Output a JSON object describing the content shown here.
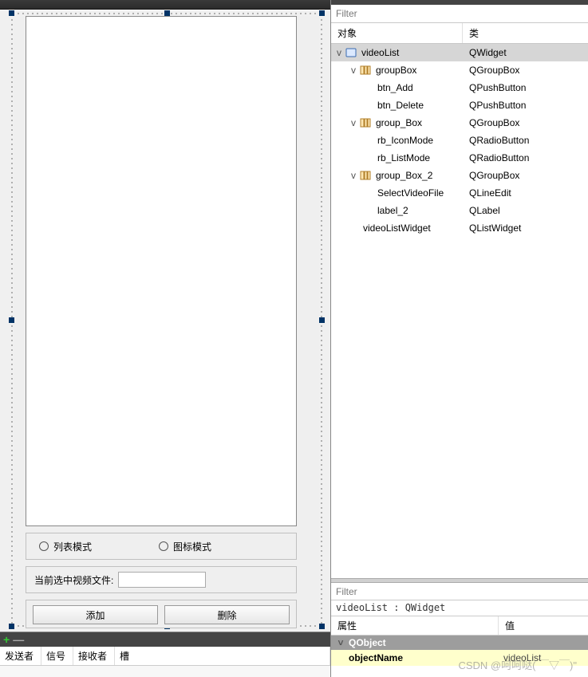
{
  "left": {
    "radio_list_label": "列表模式",
    "radio_icon_label": "图标模式",
    "selected_label": "当前选中视频文件:",
    "selected_value": "",
    "btn_add": "添加",
    "btn_delete": "删除"
  },
  "signals": {
    "h_sender": "发送者",
    "h_signal": "信号",
    "h_receiver": "接收者",
    "h_slot": "槽"
  },
  "inspector": {
    "filter_placeholder": "Filter",
    "col_object": "对象",
    "col_class": "类",
    "tree": [
      {
        "depth": 0,
        "expand": "v",
        "icon": "widget",
        "name": "videoList",
        "cls": "QWidget",
        "sel": true
      },
      {
        "depth": 1,
        "expand": "v",
        "icon": "layout",
        "name": "groupBox",
        "cls": "QGroupBox"
      },
      {
        "depth": 2,
        "expand": "",
        "icon": "",
        "name": "btn_Add",
        "cls": "QPushButton"
      },
      {
        "depth": 2,
        "expand": "",
        "icon": "",
        "name": "btn_Delete",
        "cls": "QPushButton"
      },
      {
        "depth": 1,
        "expand": "v",
        "icon": "layout",
        "name": "group_Box",
        "cls": "QGroupBox"
      },
      {
        "depth": 2,
        "expand": "",
        "icon": "",
        "name": "rb_IconMode",
        "cls": "QRadioButton"
      },
      {
        "depth": 2,
        "expand": "",
        "icon": "",
        "name": "rb_ListMode",
        "cls": "QRadioButton"
      },
      {
        "depth": 1,
        "expand": "v",
        "icon": "layout",
        "name": "group_Box_2",
        "cls": "QGroupBox"
      },
      {
        "depth": 2,
        "expand": "",
        "icon": "",
        "name": "SelectVideoFile",
        "cls": "QLineEdit"
      },
      {
        "depth": 2,
        "expand": "",
        "icon": "",
        "name": "label_2",
        "cls": "QLabel"
      },
      {
        "depth": 1,
        "expand": "",
        "icon": "",
        "name": "videoListWidget",
        "cls": "QListWidget"
      }
    ]
  },
  "props": {
    "filter_placeholder": "Filter",
    "header": "videoList : QWidget",
    "col_attr": "属性",
    "col_value": "值",
    "group": "QObject",
    "row_name": "objectName",
    "row_value": "videoList"
  },
  "watermark": "CSDN @呵呵哒( ￣▽￣)\""
}
